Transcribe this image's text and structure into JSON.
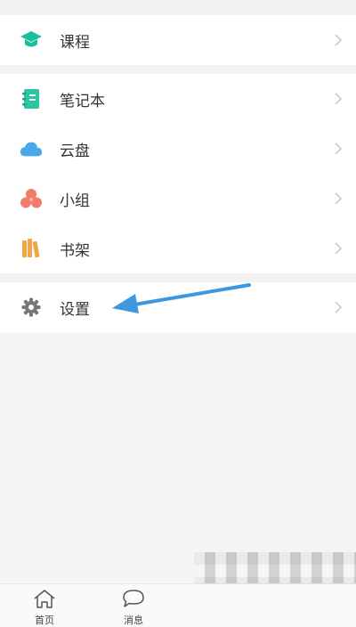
{
  "menu": {
    "course_label": "课程",
    "notebook_label": "笔记本",
    "cloud_label": "云盘",
    "group_label": "小组",
    "bookshelf_label": "书架",
    "settings_label": "设置"
  },
  "tabbar": {
    "home_label": "首页",
    "messages_label": "消息"
  },
  "colors": {
    "course_icon": "#1bbf9e",
    "notebook_icon": "#2cc4a0",
    "cloud_icon": "#4aa9e8",
    "group_icon": "#ef7d6a",
    "bookshelf_icon": "#f0a646",
    "settings_icon": "#777777",
    "annotation_arrow": "#3d98e0"
  }
}
